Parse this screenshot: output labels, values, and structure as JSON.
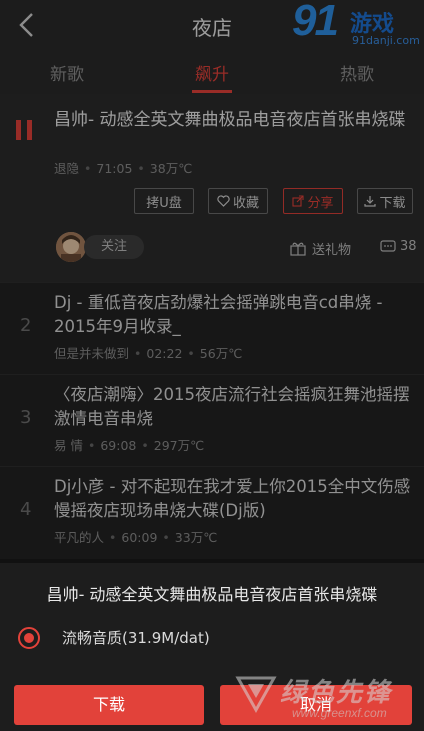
{
  "header": {
    "title": "夜店"
  },
  "logo": {
    "brand": "91",
    "name": "游戏",
    "url": "91danji.com"
  },
  "tabs": [
    {
      "label": "新歌",
      "active": false
    },
    {
      "label": "飙升",
      "active": true
    },
    {
      "label": "热歌",
      "active": false
    }
  ],
  "current": {
    "title": "昌帅- 动感全英文舞曲极品电音夜店首张串烧碟",
    "artist": "退隐",
    "duration": "71:05",
    "plays": "38万℃",
    "actions": [
      "拷U盘",
      "收藏",
      "分享",
      "下载"
    ],
    "follow_label": "关注",
    "gift_label": "送礼物",
    "comment_count": "38"
  },
  "songs": [
    {
      "rank": "2",
      "title": "Dj - 重低音夜店劲爆社会摇弹跳电音cd串烧 - 2015年9月收录_",
      "artist": "但是并未做到",
      "duration": "02:22",
      "plays": "56万℃"
    },
    {
      "rank": "3",
      "title": "〈夜店潮嗨〉2015夜店流行社会摇疯狂舞池摇摆激情电音串烧",
      "artist": "易 情",
      "duration": "69:08",
      "plays": "297万℃"
    },
    {
      "rank": "4",
      "title": "Dj小彦 - 对不起现在我才爱上你2015全中文伤感慢摇夜店现场串烧大碟(Dj版)",
      "artist": "平凡的人",
      "duration": "60:09",
      "plays": "33万℃"
    }
  ],
  "sheet": {
    "title": "昌帅- 动感全英文舞曲极品电音夜店首张串烧碟",
    "quality": "流畅音质(31.9M/dat)",
    "download_label": "下载",
    "cancel_label": "取消"
  },
  "watermark": {
    "name": "绿色先锋",
    "url": "www.greenxf.com"
  },
  "colors": {
    "accent": "#e2423a",
    "background": "#1a1a1a"
  }
}
